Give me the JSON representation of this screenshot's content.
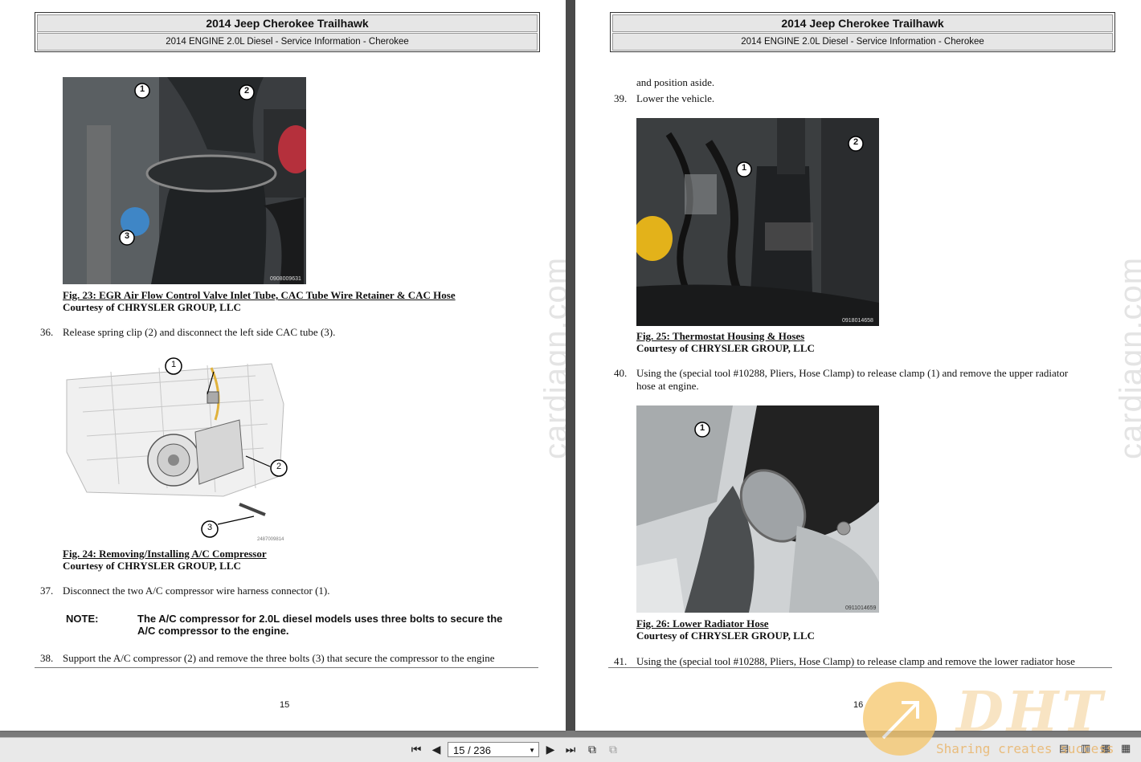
{
  "header": {
    "title": "2014 Jeep Cherokee Trailhawk",
    "subtitle": "2014 ENGINE 2.0L Diesel - Service Information - Cherokee"
  },
  "watermark": "cardiagn.com",
  "page15": {
    "fig23": {
      "caption": "Fig. 23: EGR Air Flow Control Valve Inlet Tube, CAC Tube Wire Retainer & CAC Hose",
      "courtesy": "Courtesy of CHRYSLER GROUP, LLC",
      "callouts": [
        "1",
        "2",
        "3"
      ],
      "code": "0908009631"
    },
    "step36": {
      "num": "36.",
      "text": "Release spring clip (2) and disconnect the left side CAC tube (3)."
    },
    "fig24": {
      "caption": "Fig. 24: Removing/Installing A/C Compressor",
      "courtesy": "Courtesy of CHRYSLER GROUP, LLC",
      "callouts": [
        "1",
        "2",
        "3"
      ],
      "code": "2487009814"
    },
    "step37": {
      "num": "37.",
      "text": "Disconnect the two A/C compressor wire harness connector (1)."
    },
    "note": {
      "label": "NOTE:",
      "line1": "The A/C compressor for 2.0L diesel models uses three bolts to secure the",
      "line2": "A/C compressor to the engine."
    },
    "step38": {
      "num": "38.",
      "text": "Support the A/C compressor (2) and remove the three bolts (3) that secure the compressor to the engine"
    },
    "page_number": "15"
  },
  "page16": {
    "cont": "and position aside.",
    "step39": {
      "num": "39.",
      "text": "Lower the vehicle."
    },
    "fig25": {
      "caption": "Fig. 25: Thermostat Housing & Hoses",
      "courtesy": "Courtesy of CHRYSLER GROUP, LLC",
      "callouts": [
        "1",
        "2"
      ],
      "code": "0918014658"
    },
    "step40": {
      "num": "40.",
      "line1": "Using the (special tool #10288, Pliers, Hose Clamp) to release clamp (1) and remove the upper radiator",
      "line2": "hose at engine."
    },
    "fig26": {
      "caption": "Fig. 26: Lower Radiator Hose",
      "courtesy": "Courtesy of CHRYSLER GROUP, LLC",
      "callouts": [
        "1"
      ],
      "code": "0911014659"
    },
    "step41": {
      "num": "41.",
      "text": "Using the (special tool #10288, Pliers, Hose Clamp) to release clamp and remove the lower radiator hose"
    },
    "page_number": "16"
  },
  "toolbar": {
    "page_indicator": "15 / 236"
  },
  "badge": {
    "logo": "DHT",
    "slogan": "Sharing creates success"
  }
}
